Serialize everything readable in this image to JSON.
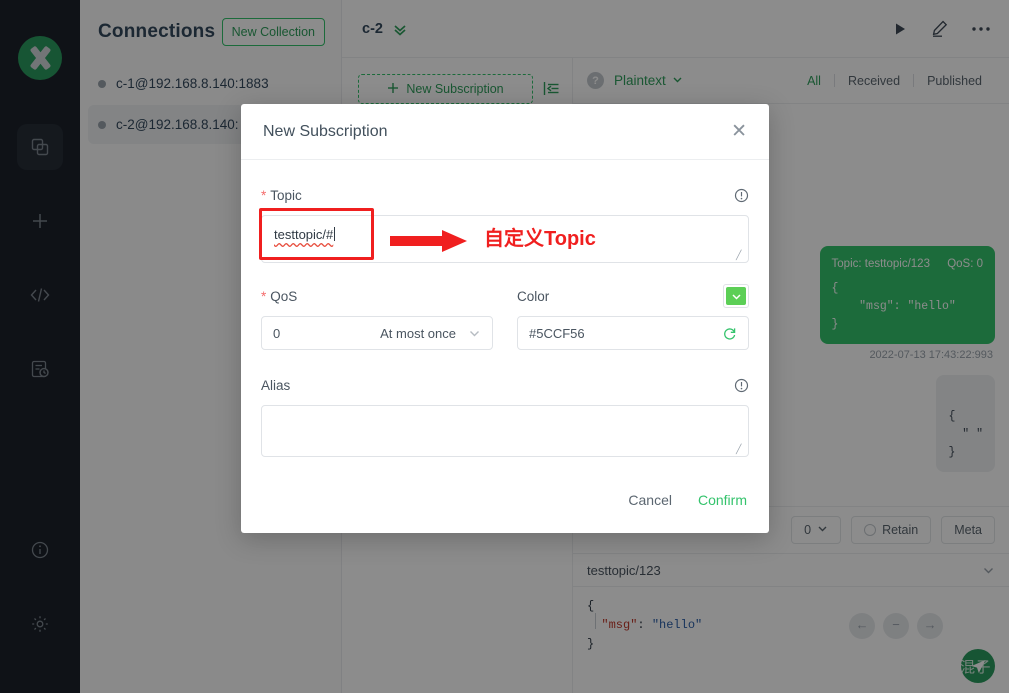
{
  "app": {
    "logo_icon": "mqttx-logo-icon"
  },
  "rail": {
    "items": [
      {
        "icon": "connections-icon",
        "active": true
      },
      {
        "icon": "plus-icon",
        "active": false
      },
      {
        "icon": "code-icon",
        "active": false
      },
      {
        "icon": "script-log-icon",
        "active": false
      }
    ],
    "bottom": [
      {
        "icon": "info-icon"
      },
      {
        "icon": "gear-icon"
      }
    ]
  },
  "connections": {
    "title": "Connections",
    "new_collection_label": "New Collection",
    "items": [
      {
        "name": "c-1@192.168.8.140:1883",
        "selected": false
      },
      {
        "name": "c-2@192.168.8.140:",
        "selected": true
      }
    ]
  },
  "main": {
    "client_name": "c-2",
    "expand_icon": "chevron-double-down-icon",
    "actions": [
      {
        "icon": "play-icon"
      },
      {
        "icon": "edit-pencil-icon"
      },
      {
        "icon": "more-dots-icon"
      }
    ],
    "new_subscription_label": "New Subscription",
    "collapse_icon": "collapse-panel-icon",
    "format_label": "Plaintext",
    "help_icon": "help-icon",
    "filters": [
      {
        "label": "All",
        "active": true
      },
      {
        "label": "Received",
        "active": false
      },
      {
        "label": "Published",
        "active": false
      }
    ]
  },
  "messages": [
    {
      "kind": "sent",
      "topic_label": "Topic: testtopic/123",
      "qos_label": "QoS: 0",
      "payload": "{\n    \"msg\": \"hello\"\n}",
      "timestamp": "2022-07-13 17:43:22:993"
    }
  ],
  "publish": {
    "qos_value": "0",
    "retain_label": "Retain",
    "meta_label": "Meta",
    "topic": "testtopic/123",
    "payload_open": "{",
    "payload_key": "\"msg\"",
    "payload_colon": ": ",
    "payload_value": "\"hello\"",
    "payload_close": "}",
    "nav_icons": [
      {
        "icon": "arrow-left-icon",
        "glyph": "←"
      },
      {
        "icon": "minus-icon",
        "glyph": "−"
      },
      {
        "icon": "arrow-right-icon",
        "glyph": "→"
      }
    ],
    "send_icon": "send-icon",
    "watermark": "CSDN @运维混子"
  },
  "modal": {
    "title": "New Subscription",
    "close_icon": "close-icon",
    "topic": {
      "label": "Topic",
      "required": true,
      "value": "testtopic/#",
      "info_icon": "info-circle-icon"
    },
    "qos": {
      "label": "QoS",
      "required": true,
      "value": "0",
      "value_text": "At most once",
      "chevron_icon": "chevron-down-icon"
    },
    "color": {
      "label": "Color",
      "value": "#5CCF56",
      "swatch_color": "#5CCF56",
      "swatch_icon": "chevron-down-icon",
      "refresh_icon": "refresh-icon"
    },
    "alias": {
      "label": "Alias",
      "value": "",
      "info_icon": "info-circle-icon"
    },
    "cancel_label": "Cancel",
    "confirm_label": "Confirm"
  },
  "annotation": {
    "text": "自定义Topic",
    "color": "#f01f1f",
    "arrow_icon": "red-arrow-right-icon",
    "highlight_icon": "red-highlight-box"
  }
}
